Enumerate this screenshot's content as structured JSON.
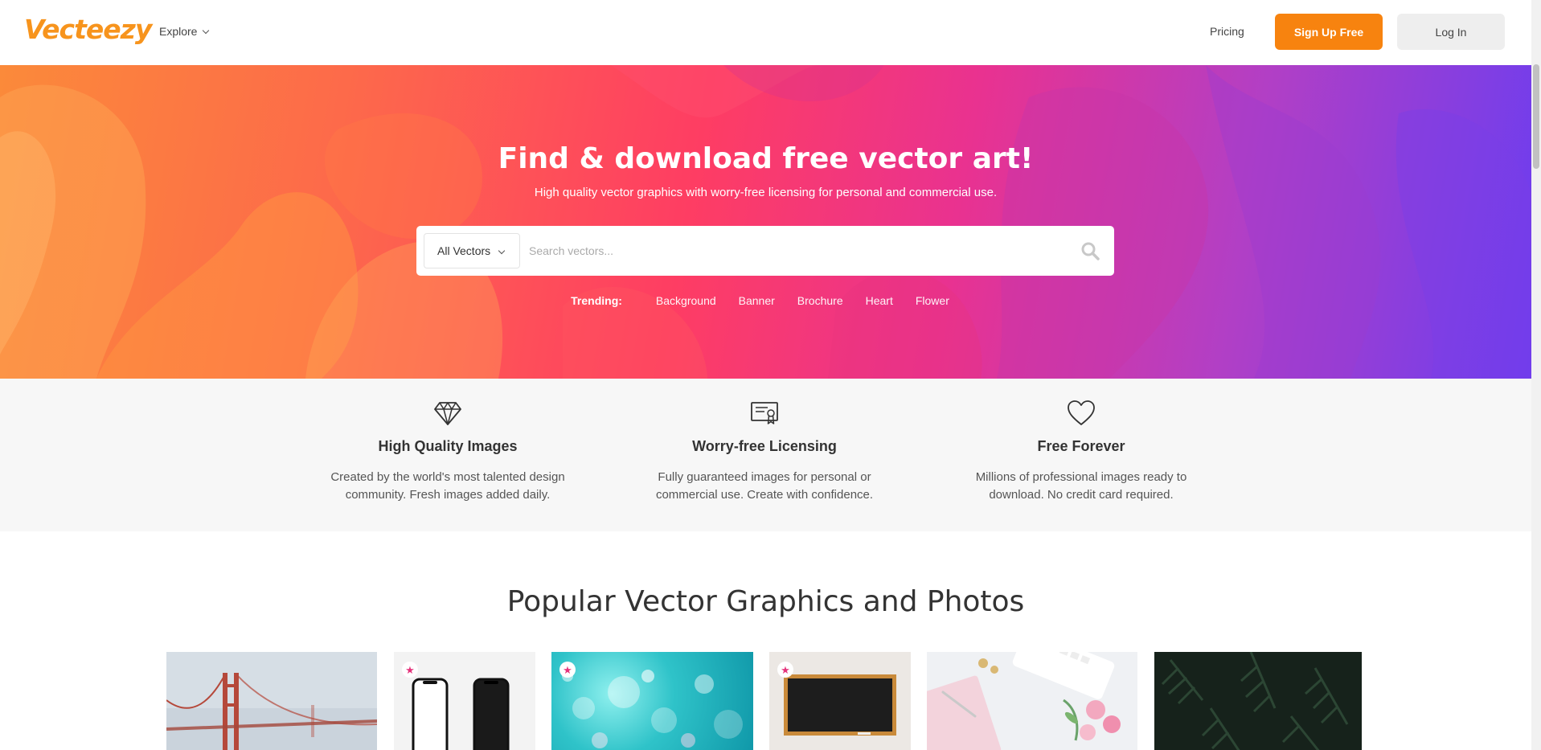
{
  "header": {
    "logo": "Vecteezy",
    "explore_label": "Explore",
    "pricing_label": "Pricing",
    "signup_label": "Sign Up Free",
    "login_label": "Log In"
  },
  "hero": {
    "title": "Find & download free vector art!",
    "subtitle": "High quality vector graphics with worry-free licensing for personal and commercial use.",
    "search": {
      "category": "All Vectors",
      "placeholder": "Search vectors..."
    },
    "trending_label": "Trending:",
    "trending": [
      "Background",
      "Banner",
      "Brochure",
      "Heart",
      "Flower"
    ]
  },
  "features": [
    {
      "icon": "diamond-icon",
      "title": "High Quality Images",
      "line1": "Created by the world's most talented design",
      "line2": "community. Fresh images added daily."
    },
    {
      "icon": "certificate-icon",
      "title": "Worry-free Licensing",
      "line1": "Fully guaranteed images for personal or",
      "line2": "commercial use. Create with confidence."
    },
    {
      "icon": "heart-icon",
      "title": "Free Forever",
      "line1": "Millions of professional images ready to",
      "line2": "download. No credit card required."
    }
  ],
  "popular": {
    "title": "Popular Vector Graphics and Photos"
  },
  "colors": {
    "brand_orange": "#f7830f",
    "premium_pink": "#e5337b",
    "features_bg": "#f7f7f7"
  }
}
